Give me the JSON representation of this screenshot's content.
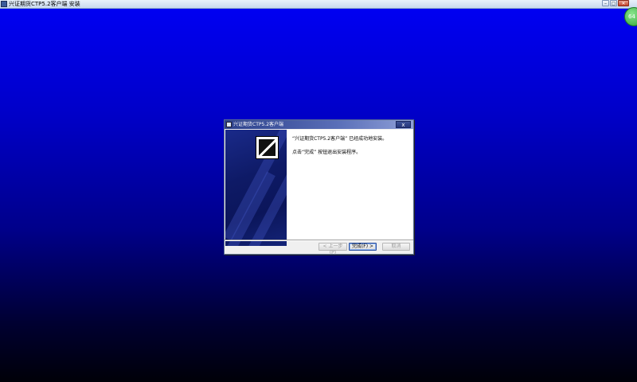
{
  "window": {
    "title": "兴证期货CTP5.2客户端 安装",
    "controls": [
      "–",
      "▢",
      "✕"
    ]
  },
  "badge": {
    "label": "64"
  },
  "dialog": {
    "title": "兴证期货CTP5.2客户端",
    "close": "x",
    "message_line1": "“兴证期货CTP5.2客户端” 已经成功地安装。",
    "message_line2": "点击“完成” 按钮退出安装程序。",
    "buttons": {
      "back": "< 上一步 (P)",
      "finish": "完成(F) >",
      "cancel": "取消"
    }
  },
  "colors": {
    "desktop_top": "#0000f5",
    "desktop_bottom": "#000008",
    "dialog_title": "#2a3f8a"
  },
  "icons": {
    "app": "installer-app-icon",
    "logo": "brand-logo-icon"
  }
}
